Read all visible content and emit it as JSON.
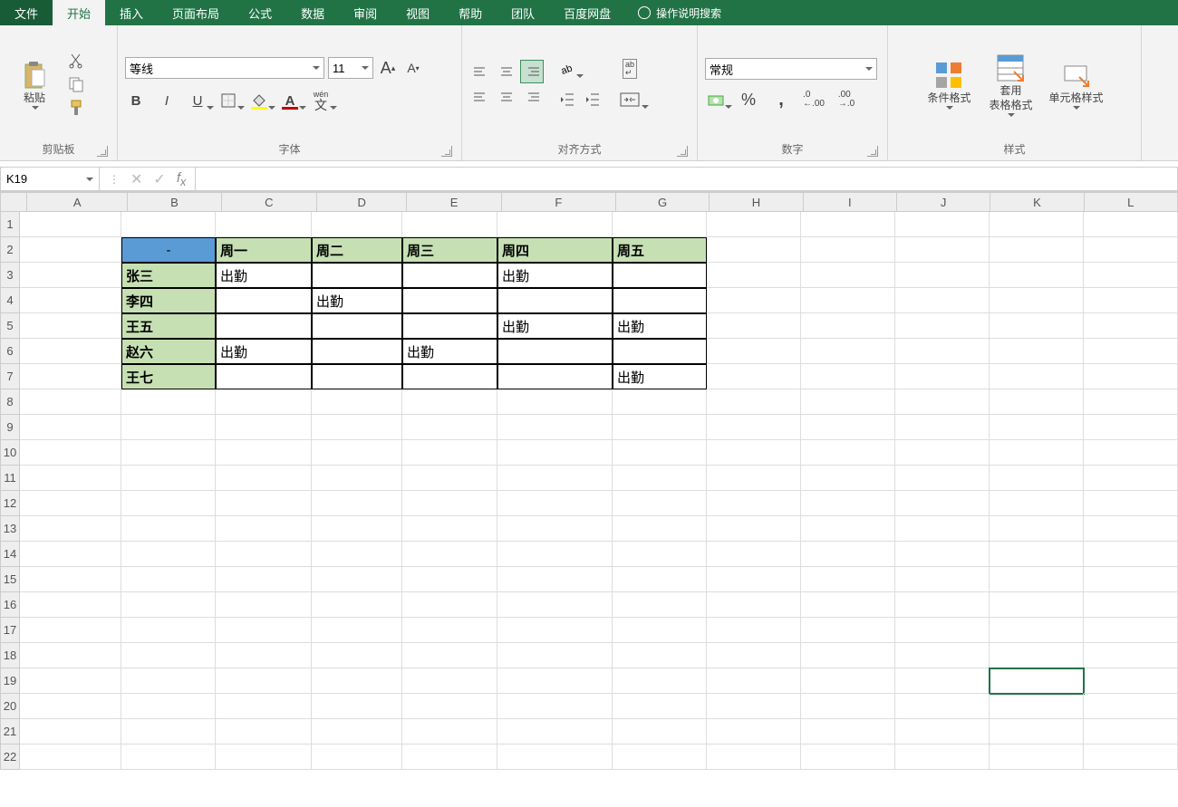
{
  "tabs": {
    "file": "文件",
    "home": "开始",
    "insert": "插入",
    "layout": "页面布局",
    "formula": "公式",
    "data": "数据",
    "review": "审阅",
    "view": "视图",
    "help": "帮助",
    "team": "团队",
    "baidu": "百度网盘",
    "search": "操作说明搜索"
  },
  "ribbon": {
    "clipboard": {
      "paste": "粘贴",
      "label": "剪贴板"
    },
    "font": {
      "name": "等线",
      "size": "11",
      "bold": "B",
      "italic": "I",
      "underline": "U",
      "phonetic": "wén",
      "phonetic2": "文",
      "label": "字体"
    },
    "align": {
      "wrap": "ab",
      "label": "对齐方式"
    },
    "number": {
      "format": "常规",
      "label": "数字"
    },
    "styles": {
      "cond": "条件格式",
      "table": "套用",
      "table2": "表格格式",
      "cell": "单元格样式",
      "label": "样式"
    }
  },
  "namebox": "K19",
  "columns": [
    "A",
    "B",
    "C",
    "D",
    "E",
    "F",
    "G",
    "H",
    "I",
    "J",
    "K",
    "L"
  ],
  "rows": [
    "1",
    "2",
    "3",
    "4",
    "5",
    "6",
    "7",
    "8",
    "9",
    "10",
    "11",
    "12",
    "13",
    "14",
    "15",
    "16",
    "17",
    "18",
    "19",
    "20",
    "21",
    "22"
  ],
  "table": {
    "corner": "-",
    "headers": [
      "周一",
      "周二",
      "周三",
      "周四",
      "周五"
    ],
    "rownames": [
      "张三",
      "李四",
      "王五",
      "赵六",
      "王七"
    ],
    "data": [
      [
        "出勤",
        "",
        "",
        "出勤",
        ""
      ],
      [
        "",
        "出勤",
        "",
        "",
        ""
      ],
      [
        "",
        "",
        "",
        "出勤",
        "出勤"
      ],
      [
        "出勤",
        "",
        "出勤",
        "",
        ""
      ],
      [
        "",
        "",
        "",
        "",
        "出勤"
      ]
    ]
  },
  "selected": {
    "row": 19,
    "col": "K"
  }
}
